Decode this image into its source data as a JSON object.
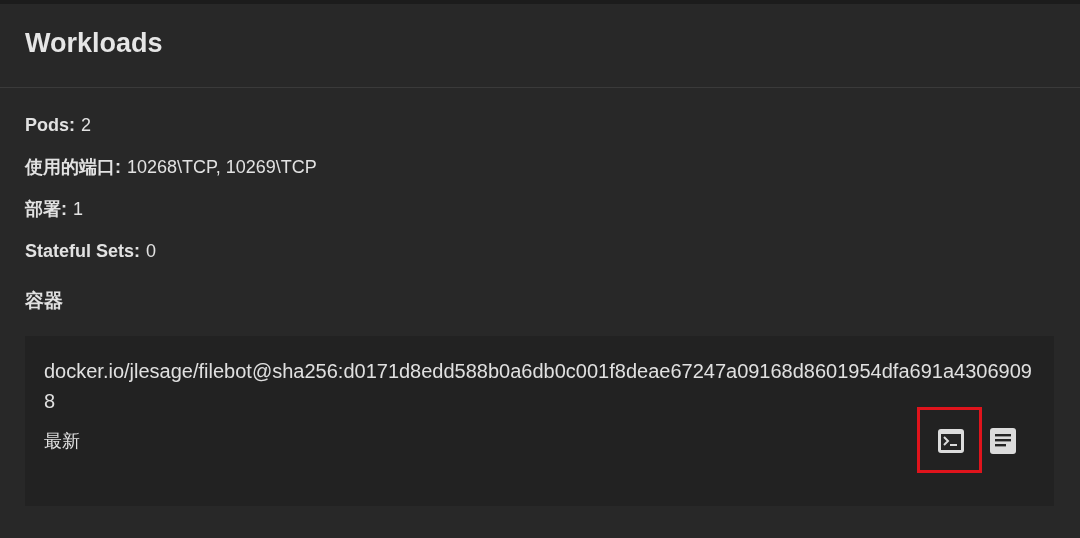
{
  "panel": {
    "title": "Workloads"
  },
  "details": [
    {
      "label": "Pods:",
      "value": "2"
    },
    {
      "label": "使用的端口:",
      "value": "10268\\TCP, 10269\\TCP"
    },
    {
      "label": "部署:",
      "value": "1"
    },
    {
      "label": "Stateful Sets:",
      "value": "0"
    }
  ],
  "containers_heading": "容器",
  "containers": [
    {
      "image": "docker.io/jlesage/filebot@sha256:d0171d8edd588b0a6db0c001f8deae67247a09168d8601954dfa691a43069098",
      "tag": "最新",
      "actions": [
        {
          "kind": "terminal",
          "highlighted": true
        },
        {
          "kind": "logs",
          "highlighted": false
        }
      ]
    }
  ]
}
